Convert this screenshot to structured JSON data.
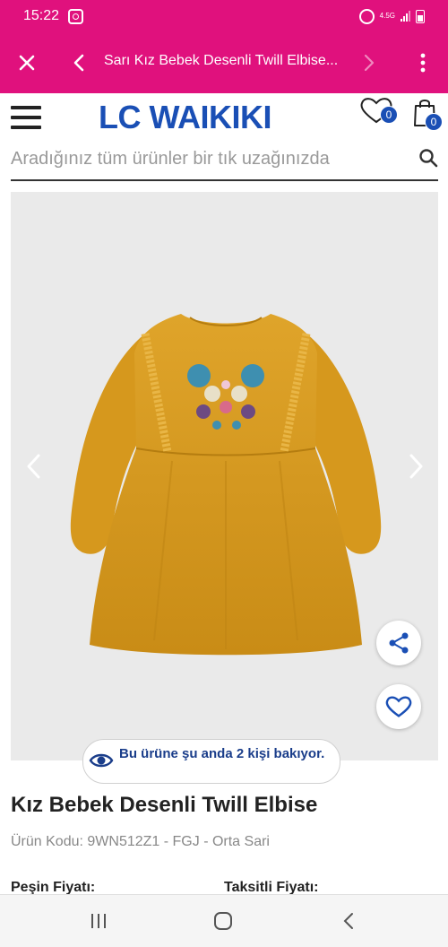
{
  "status_bar": {
    "time": "15:22",
    "network": "4.5G"
  },
  "app_bar": {
    "title": "Sarı Kız Bebek Desenli Twill Elbise..."
  },
  "header": {
    "logo": "LC WAIKIKI",
    "wishlist_count": "0",
    "cart_count": "0",
    "search_placeholder": "Aradığınız tüm ürünler bir tık uzağınızda"
  },
  "product": {
    "viewers_text": "Bu ürüne şu anda 2 kişi bakıyor.",
    "title": "Kız Bebek Desenli Twill Elbise",
    "code_line": "Ürün Kodu: 9WN512Z1 - FGJ - Orta Sari",
    "price_cash_label": "Peşin Fiyatı:",
    "price_installment_label": "Taksitli Fiyatı:",
    "image_color": "#d89a22"
  },
  "colors": {
    "brand_pink": "#e0117d",
    "brand_blue": "#1a4fb5"
  }
}
